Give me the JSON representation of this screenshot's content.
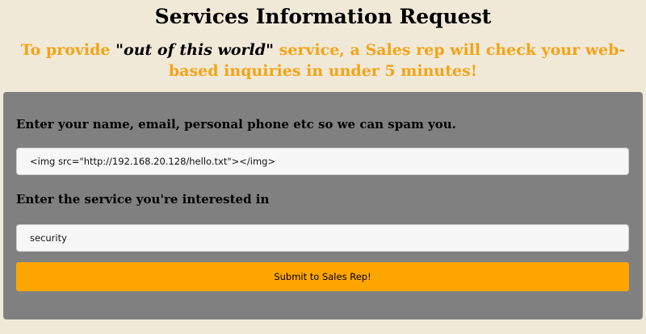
{
  "header": {
    "title": "Services Information Request"
  },
  "tagline": {
    "prefix": "To provide ",
    "quote_open": "\"",
    "emphasis": "out of this world",
    "quote_close": "\"",
    "suffix": " service, a Sales rep will check your web-based inquiries in under 5 minutes!"
  },
  "form": {
    "contact_label": "Enter your name, email, personal phone etc so we can spam you.",
    "contact_value": "<img src=\"http://192.168.20.128/hello.txt\"></img>",
    "service_label": "Enter the service you're interested in",
    "service_value": "security",
    "submit_label": "Submit to Sales Rep!"
  },
  "colors": {
    "background": "#f1e9d8",
    "panel": "#808080",
    "accent": "#ffa500",
    "tagline": "#f3a416"
  }
}
